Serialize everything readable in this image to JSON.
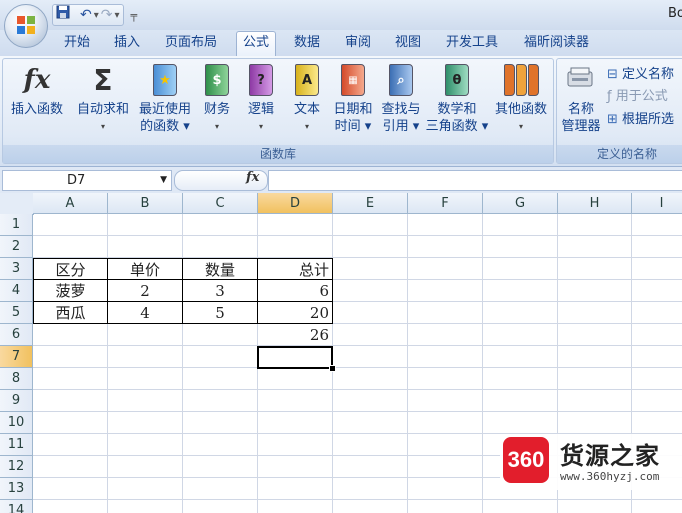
{
  "window": {
    "title_partial": "Bo"
  },
  "tabs": [
    "开始",
    "插入",
    "页面布局",
    "公式",
    "数据",
    "审阅",
    "视图",
    "开发工具",
    "福昕阅读器"
  ],
  "active_tab": "公式",
  "ribbon": {
    "function_library": {
      "group_label": "函数库",
      "buttons": [
        {
          "line1": "插入函数",
          "line2": "",
          "icon": "fx-icon"
        },
        {
          "line1": "自动求和",
          "line2": "▾",
          "icon": "sigma-icon"
        },
        {
          "line1": "最近使用",
          "line2": "的函数 ▾",
          "icon": "star-book-icon"
        },
        {
          "line1": "财务",
          "line2": "▾",
          "icon": "finance-book-icon"
        },
        {
          "line1": "逻辑",
          "line2": "▾",
          "icon": "logic-book-icon"
        },
        {
          "line1": "文本",
          "line2": "▾",
          "icon": "text-book-icon"
        },
        {
          "line1": "日期和",
          "line2": "时间 ▾",
          "icon": "date-book-icon"
        },
        {
          "line1": "查找与",
          "line2": "引用 ▾",
          "icon": "lookup-book-icon"
        },
        {
          "line1": "数学和",
          "line2": "三角函数 ▾",
          "icon": "math-book-icon"
        },
        {
          "line1": "其他函数",
          "line2": "▾",
          "icon": "more-books-icon"
        }
      ]
    },
    "defined_names": {
      "group_label": "定义的名称",
      "name_manager_line1": "名称",
      "name_manager_line2": "管理器",
      "define_name": "定义名称",
      "use_in_formula": "用于公式",
      "create_from_selection": "根据所选"
    }
  },
  "formula_bar": {
    "name_box": "D7",
    "fx_label": "fx",
    "formula": ""
  },
  "sheet": {
    "columns": [
      "A",
      "B",
      "C",
      "D",
      "E",
      "F",
      "G",
      "H",
      "I"
    ],
    "rows": [
      "1",
      "2",
      "3",
      "4",
      "5",
      "6",
      "7",
      "8",
      "9",
      "10",
      "11",
      "12",
      "13",
      "14"
    ],
    "selected_cell": "D7",
    "cells": {
      "A3": "区分",
      "B3": "单价",
      "C3": "数量",
      "D3": "总计",
      "A4": "菠萝",
      "B4": "2",
      "C4": "3",
      "D4": "6",
      "A5": "西瓜",
      "B5": "4",
      "C5": "5",
      "D5": "20",
      "D6": "26"
    }
  },
  "watermark": {
    "logo_text": "360",
    "title": "货源之家",
    "url": "www.360hyzj.com"
  }
}
